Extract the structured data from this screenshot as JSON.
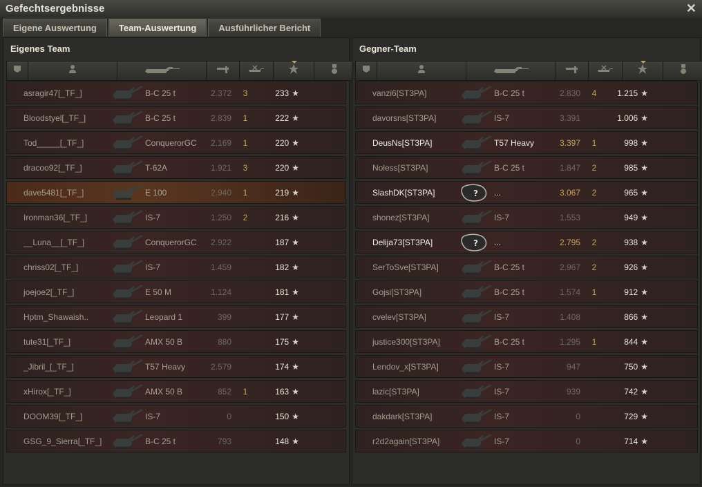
{
  "window": {
    "title": "Gefechtsergebnisse",
    "close_label": "✕"
  },
  "tabs": [
    {
      "label": "Eigene Auswertung",
      "active": false
    },
    {
      "label": "Team-Auswertung",
      "active": true
    },
    {
      "label": "Ausführlicher Bericht",
      "active": false
    }
  ],
  "columns": [
    "squad-icon",
    "player-icon",
    "tank-icon",
    "damage-icon",
    "kills-icon",
    "xp-star-icon",
    "medal-icon"
  ],
  "sort_column": "xp",
  "star": "★",
  "teams": [
    {
      "title": "Eigenes Team",
      "players": [
        {
          "name": "asragir47[_TF_]",
          "tank": "B-C 25 t",
          "damage": "2.372",
          "kills": "3",
          "xp": "233",
          "alive": false,
          "me": false
        },
        {
          "name": "Bloodstyel[_TF_]",
          "tank": "B-C 25 t",
          "damage": "2.839",
          "kills": "1",
          "xp": "222",
          "alive": false,
          "me": false
        },
        {
          "name": "Tod_____[_TF_]",
          "tank": "ConquerorGC",
          "damage": "2.169",
          "kills": "1",
          "xp": "220",
          "alive": false,
          "me": false
        },
        {
          "name": "dracoo92[_TF_]",
          "tank": "T-62A",
          "damage": "1.921",
          "kills": "3",
          "xp": "220",
          "alive": false,
          "me": false
        },
        {
          "name": "dave5481[_TF_]",
          "tank": "E 100",
          "damage": "2.940",
          "kills": "1",
          "xp": "219",
          "alive": false,
          "me": true
        },
        {
          "name": "Ironman36[_TF_]",
          "tank": "IS-7",
          "damage": "1.250",
          "kills": "2",
          "xp": "216",
          "alive": false,
          "me": false
        },
        {
          "name": "__Luna__[_TF_]",
          "tank": "ConquerorGC",
          "damage": "2.922",
          "kills": "",
          "xp": "187",
          "alive": false,
          "me": false
        },
        {
          "name": "chriss02[_TF_]",
          "tank": "IS-7",
          "damage": "1.459",
          "kills": "",
          "xp": "182",
          "alive": false,
          "me": false
        },
        {
          "name": "joejoe2[_TF_]",
          "tank": "E 50 M",
          "damage": "1.124",
          "kills": "",
          "xp": "181",
          "alive": false,
          "me": false
        },
        {
          "name": "Hptm_Shawaish..",
          "tank": "Leopard 1",
          "damage": "399",
          "kills": "",
          "xp": "177",
          "alive": false,
          "me": false
        },
        {
          "name": "tute31[_TF_]",
          "tank": "AMX 50 B",
          "damage": "880",
          "kills": "",
          "xp": "175",
          "alive": false,
          "me": false
        },
        {
          "name": "_Jibril_[_TF_]",
          "tank": "T57 Heavy",
          "damage": "2.579",
          "kills": "",
          "xp": "174",
          "alive": false,
          "me": false
        },
        {
          "name": "xHirox[_TF_]",
          "tank": "AMX 50 B",
          "damage": "852",
          "kills": "1",
          "xp": "163",
          "alive": false,
          "me": false
        },
        {
          "name": "DOOM39[_TF_]",
          "tank": "IS-7",
          "damage": "0",
          "kills": "",
          "xp": "150",
          "alive": false,
          "me": false
        },
        {
          "name": "GSG_9_Sierra[_TF_]",
          "tank": "B-C 25 t",
          "damage": "793",
          "kills": "",
          "xp": "148",
          "alive": false,
          "me": false
        }
      ]
    },
    {
      "title": "Gegner-Team",
      "players": [
        {
          "name": "vanzi6[ST3PA]",
          "tank": "B-C 25 t",
          "damage": "2.830",
          "kills": "4",
          "xp": "1.215",
          "alive": false,
          "me": false
        },
        {
          "name": "davorsns[ST3PA]",
          "tank": "IS-7",
          "damage": "3.391",
          "kills": "",
          "xp": "1.006",
          "alive": false,
          "me": false
        },
        {
          "name": "DeusNs[ST3PA]",
          "tank": "T57 Heavy",
          "damage": "3.397",
          "kills": "1",
          "xp": "998",
          "alive": true,
          "me": false
        },
        {
          "name": "Noless[ST3PA]",
          "tank": "B-C 25 t",
          "damage": "1.847",
          "kills": "2",
          "xp": "985",
          "alive": false,
          "me": false
        },
        {
          "name": "SlashDK[ST3PA]",
          "tank": "...",
          "damage": "3.067",
          "kills": "2",
          "xp": "965",
          "alive": true,
          "me": false,
          "unknown": true
        },
        {
          "name": "shonez[ST3PA]",
          "tank": "IS-7",
          "damage": "1.553",
          "kills": "",
          "xp": "949",
          "alive": false,
          "me": false
        },
        {
          "name": "Delija73[ST3PA]",
          "tank": "...",
          "damage": "2.795",
          "kills": "2",
          "xp": "938",
          "alive": true,
          "me": false,
          "unknown": true
        },
        {
          "name": "SerToSve[ST3PA]",
          "tank": "B-C 25 t",
          "damage": "2.967",
          "kills": "2",
          "xp": "926",
          "alive": false,
          "me": false
        },
        {
          "name": "Gojsi[ST3PA]",
          "tank": "B-C 25 t",
          "damage": "1.574",
          "kills": "1",
          "xp": "912",
          "alive": false,
          "me": false
        },
        {
          "name": "cvelev[ST3PA]",
          "tank": "IS-7",
          "damage": "1.408",
          "kills": "",
          "xp": "866",
          "alive": false,
          "me": false
        },
        {
          "name": "justice300[ST3PA]",
          "tank": "B-C 25 t",
          "damage": "1.295",
          "kills": "1",
          "xp": "844",
          "alive": false,
          "me": false
        },
        {
          "name": "Lendov_x[ST3PA]",
          "tank": "IS-7",
          "damage": "947",
          "kills": "",
          "xp": "750",
          "alive": false,
          "me": false
        },
        {
          "name": "lazic[ST3PA]",
          "tank": "IS-7",
          "damage": "939",
          "kills": "",
          "xp": "742",
          "alive": false,
          "me": false
        },
        {
          "name": "dakdark[ST3PA]",
          "tank": "IS-7",
          "damage": "0",
          "kills": "",
          "xp": "729",
          "alive": false,
          "me": false
        },
        {
          "name": "r2d2again[ST3PA]",
          "tank": "IS-7",
          "damage": "0",
          "kills": "",
          "xp": "714",
          "alive": false,
          "me": false
        }
      ]
    }
  ]
}
